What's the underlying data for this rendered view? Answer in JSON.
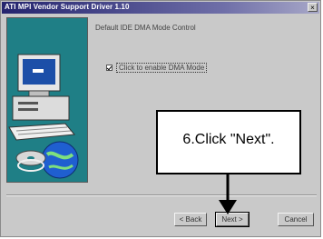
{
  "window": {
    "title": "ATI MPI Vendor Support Driver 1.10",
    "close_glyph": "×"
  },
  "content": {
    "heading": "Default IDE DMA Mode Control",
    "checkbox_label": "Click to enable DMA Mode",
    "checkbox_checked": true
  },
  "buttons": {
    "back": "< Back",
    "next": "Next >",
    "cancel": "Cancel"
  },
  "annotation": {
    "callout_text": "6.Click \"Next\"."
  },
  "colors": {
    "dialog_background": "#c9c9c9",
    "titlebar": "#24246e",
    "artwork_background": "#1f7f86"
  }
}
